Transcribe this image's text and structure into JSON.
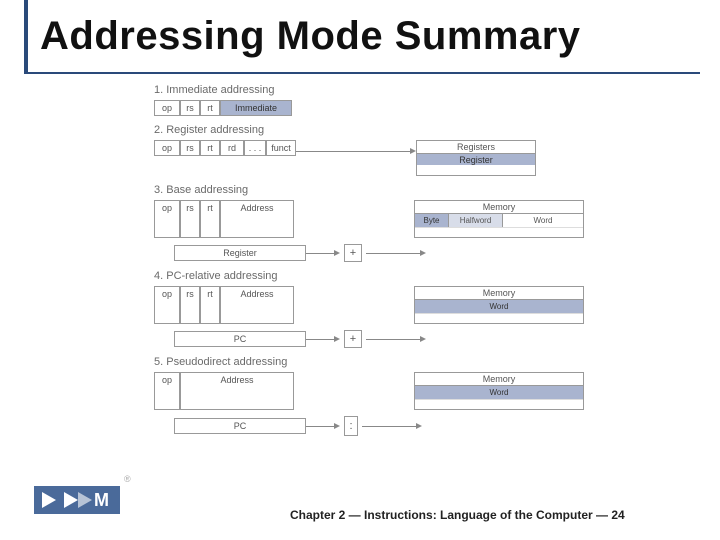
{
  "title": "Addressing Mode Summary",
  "fields": {
    "op": "op",
    "rs": "rs",
    "rt": "rt",
    "rd": "rd",
    "dots": ". . .",
    "funct": "funct",
    "immediate": "Immediate",
    "address": "Address",
    "register_word": "Register",
    "pc": "PC"
  },
  "labels": {
    "registers": "Registers",
    "register": "Register",
    "memory": "Memory",
    "byte": "Byte",
    "halfword": "Halfword",
    "word": "Word",
    "plus": "+",
    "concat": ":"
  },
  "modes": {
    "m1": "1. Immediate addressing",
    "m2": "2. Register addressing",
    "m3": "3. Base addressing",
    "m4": "4. PC-relative addressing",
    "m5": "5. Pseudodirect addressing"
  },
  "footer": "Chapter 2 — Instructions: Language of the Computer — 24",
  "reg_mark": "®"
}
